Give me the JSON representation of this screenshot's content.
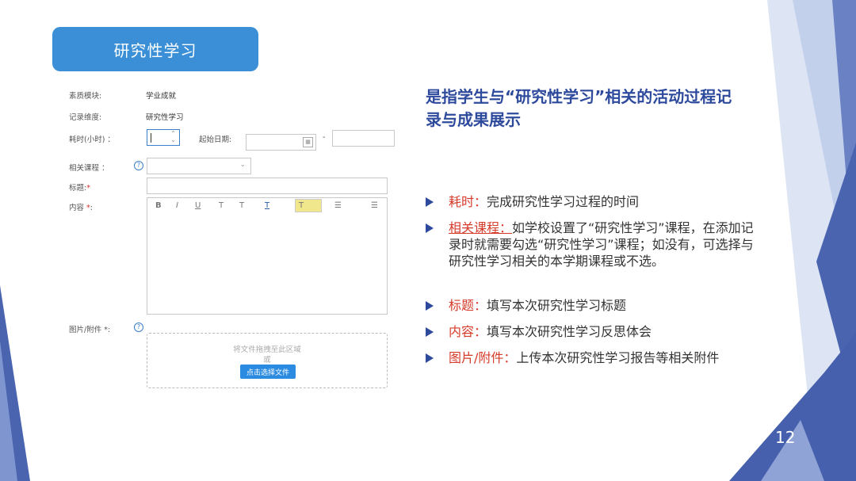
{
  "slide": {
    "title": "研究性学习",
    "page_number": "12"
  },
  "form": {
    "module_label": "素质模块:",
    "module_value": "学业成就",
    "dimension_label": "记录维度:",
    "dimension_value": "研究性学习",
    "hours_label": "耗时(小时) ：",
    "start_date_label": "起始日期:",
    "date_separator": "-",
    "course_label": "相关课程 ：",
    "title_label": "标题:",
    "content_label": "内容",
    "required_mark": "*",
    "attachment_label": "图片/附件 *:",
    "toolbar": [
      "B",
      "I",
      "U",
      "T",
      "T",
      "T",
      "T"
    ],
    "dropzone_hint": "将文件拖拽至此区域",
    "dropzone_or": "或",
    "dropzone_button": "点击选择文件"
  },
  "heading": "是指学生与“研究性学习”相关的活动过程记录与成果展示",
  "bullets": [
    {
      "keyword": "耗时：",
      "text": "完成研究性学习过程的时间"
    },
    {
      "keyword": "相关课程：",
      "text": "如学校设置了“研究性学习”课程，在添加记录时就需要勾选“研究性学习”课程；如没有，可选择与研究性学习相关的本学期课程或不选。"
    },
    {
      "keyword": "标题：",
      "text": "填写本次研究性学习标题"
    },
    {
      "keyword": "内容：",
      "text": "填写本次研究性学习反思体会"
    },
    {
      "keyword": "图片/附件：",
      "text": "上传本次研究性学习报告等相关附件"
    }
  ],
  "colors": {
    "pill": "#3a8fd6",
    "heading": "#2e4a9c",
    "keyword": "#d63b2a",
    "decor_dark": "#4a64b0",
    "decor_light": "#b3c3e6"
  }
}
